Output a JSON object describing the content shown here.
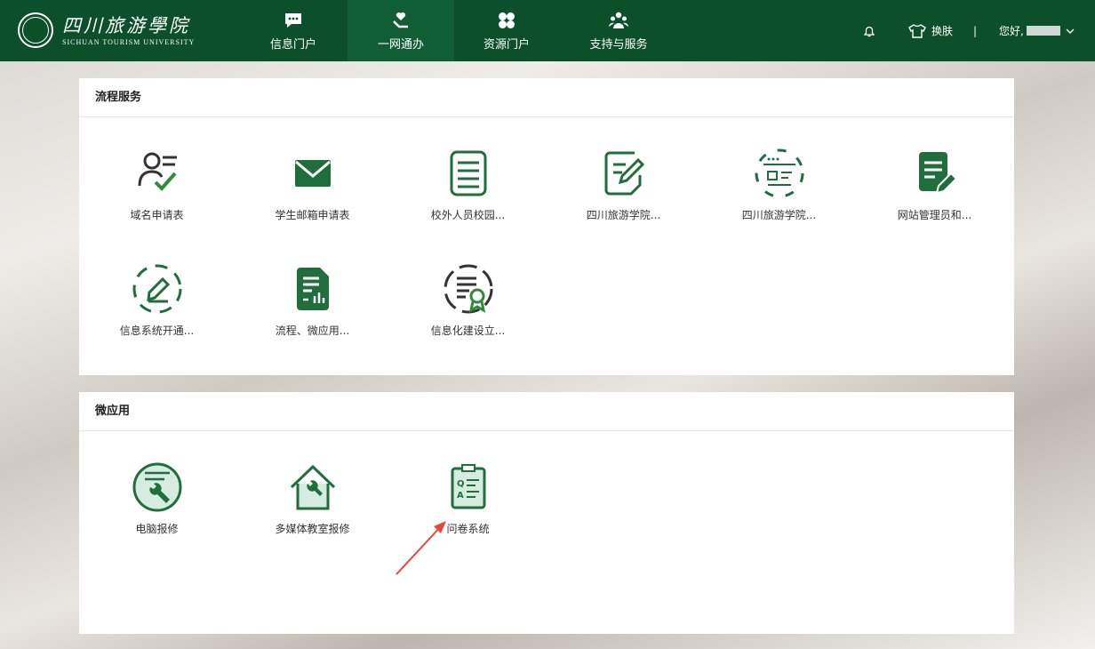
{
  "header": {
    "logo_cn": "四川旅游學院",
    "logo_en": "SICHUAN TOURISM UNIVERSITY",
    "nav": [
      {
        "label": "信息门户",
        "icon": "chat-icon",
        "active": false
      },
      {
        "label": "一网通办",
        "icon": "heart-hand-icon",
        "active": true
      },
      {
        "label": "资源门户",
        "icon": "clover-icon",
        "active": false
      },
      {
        "label": "支持与服务",
        "icon": "team-icon",
        "active": false
      }
    ],
    "skin_label": "换肤",
    "separator": "|",
    "greeting": "您好,"
  },
  "process_panel": {
    "title": "流程服务",
    "items": [
      {
        "label": "域名申请表",
        "icon": "user-check-icon"
      },
      {
        "label": "学生邮箱申请表",
        "icon": "envelope-icon"
      },
      {
        "label": "校外人员校园...",
        "icon": "document-list-icon"
      },
      {
        "label": "四川旅游学院...",
        "icon": "document-edit-icon"
      },
      {
        "label": "四川旅游学院...",
        "icon": "web-page-icon"
      },
      {
        "label": "网站管理员和...",
        "icon": "document-pen-icon"
      },
      {
        "label": "信息系统开通...",
        "icon": "pencil-square-icon"
      },
      {
        "label": "流程、微应用...",
        "icon": "document-chart-icon"
      },
      {
        "label": "信息化建设立...",
        "icon": "document-award-icon"
      }
    ]
  },
  "micro_panel": {
    "title": "微应用",
    "items": [
      {
        "label": "电脑报修",
        "icon": "computer-repair-icon"
      },
      {
        "label": "多媒体教室报修",
        "icon": "house-wrench-icon"
      },
      {
        "label": "问卷系统",
        "icon": "qa-clipboard-icon"
      }
    ]
  },
  "colors": {
    "brand": "#0b4f2b",
    "accent": "#1f6e3c",
    "arrow": "#e8453c"
  }
}
